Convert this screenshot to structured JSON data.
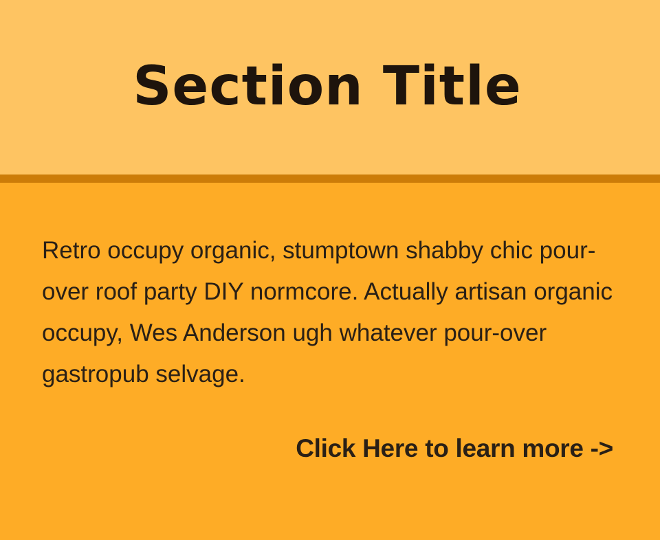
{
  "section": {
    "title": "Section Title",
    "description": "Retro occupy organic, stumptown shabby chic pour-over roof party DIY normcore. Actually artisan organic occupy, Wes Anderson ugh whatever pour-over gastropub selvage.",
    "cta_label": "Click Here to learn more ->"
  },
  "colors": {
    "header_background": "#FEC462",
    "header_rule": "#CC7C08",
    "body_background": "#FEAC26",
    "text": "#2A2016"
  }
}
